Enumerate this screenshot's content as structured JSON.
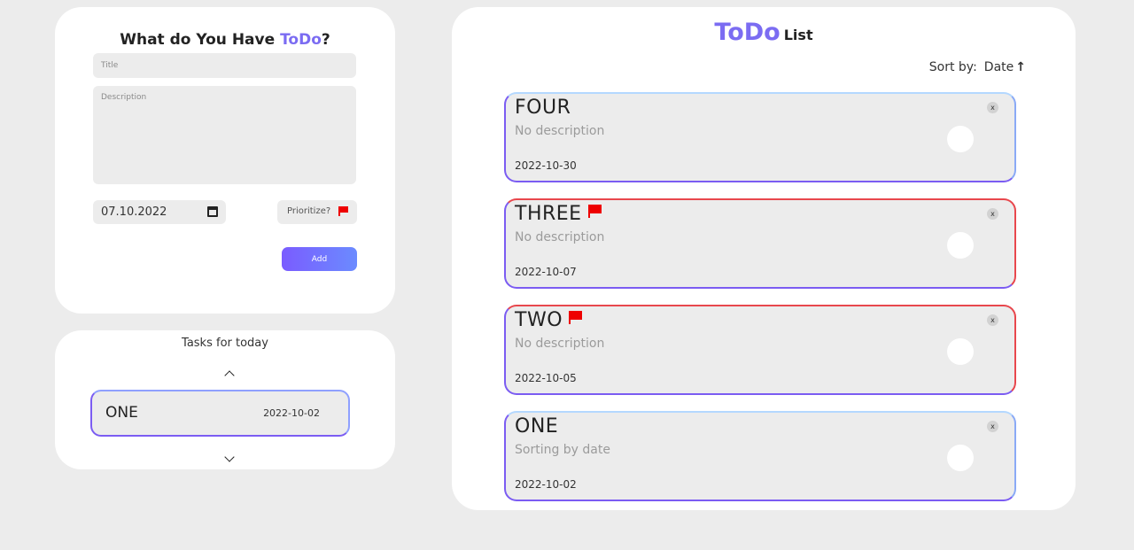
{
  "form": {
    "title_prefix": "What do You Have ",
    "title_accent": "ToDo",
    "title_suffix": "?",
    "title_placeholder": "Title",
    "description_placeholder": "Description",
    "date_value": "07.10.2022",
    "prioritize_label": "Prioritize?",
    "add_label": "Add"
  },
  "today": {
    "title": "Tasks for today",
    "item": {
      "name": "ONE",
      "date": "2022-10-02"
    }
  },
  "list": {
    "title_big": "ToDo",
    "title_small": "List",
    "sort_label": "Sort by:",
    "sort_key": "Date",
    "sort_arrow": "↑",
    "items": [
      {
        "name": "FOUR",
        "description": "No description",
        "date": "2022-10-30",
        "priority": false,
        "remove": "x"
      },
      {
        "name": "THREE",
        "description": "No description",
        "date": "2022-10-07",
        "priority": true,
        "remove": "x"
      },
      {
        "name": "TWO",
        "description": "No description",
        "date": "2022-10-05",
        "priority": true,
        "remove": "x"
      },
      {
        "name": "ONE",
        "description": "Sorting by date",
        "date": "2022-10-02",
        "priority": false,
        "remove": "x"
      }
    ]
  },
  "colors": {
    "accent": "#7b6cf2",
    "priority": "#e8474d",
    "flag": "#ee0000",
    "background": "#ececec"
  }
}
